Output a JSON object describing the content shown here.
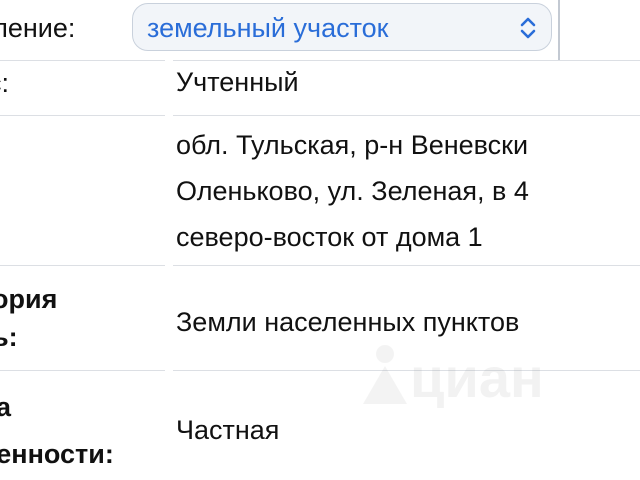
{
  "header": {
    "field_label": "еление:",
    "select_value": "земельный участок",
    "select_icon": "chevron-up-down-icon"
  },
  "rows": [
    {
      "label_lines": [
        "с:"
      ],
      "value_lines": [
        "Учтенный"
      ]
    },
    {
      "label_lines": [
        ":"
      ],
      "value_lines": [
        "обл. Тульская, р-н Веневски",
        "Оленьково, ул. Зеленая, в 4",
        "северо-восток от дома 1"
      ]
    },
    {
      "label_lines": [
        "ория",
        "ь:"
      ],
      "value_lines": [
        "Земли населенных пунктов"
      ]
    },
    {
      "label_lines": [
        "а",
        "венности:"
      ],
      "value_lines": [
        "Частная"
      ]
    }
  ],
  "watermark": {
    "brand": "циан"
  }
}
